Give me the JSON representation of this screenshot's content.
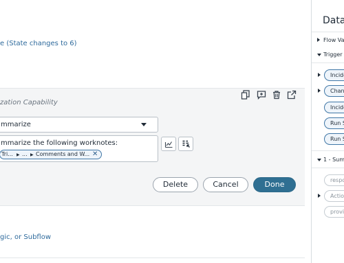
{
  "trigger": {
    "link_text": "e (State changes to 6)"
  },
  "step": {
    "title": "zation Capability",
    "capability_value": "mmarize",
    "prompt_text": "mmarize the following worknotes:",
    "pill": {
      "seg1": "Tri...",
      "seg2": "...",
      "seg3": "Comments and W..."
    },
    "close_glyph": "✕",
    "buttons": {
      "delete": "Delete",
      "cancel": "Cancel",
      "done": "Done"
    }
  },
  "add": {
    "link_text": "gic, or Subflow"
  },
  "panel": {
    "title": "Data",
    "sections": {
      "flow_variables": "Flow Va",
      "trigger": "Trigger -",
      "summarize": "1 - Summ"
    },
    "trigger_items": [
      "Incide",
      "Chan",
      "Incide",
      "Run S",
      "Run S"
    ],
    "step_items": [
      "respo",
      "Action",
      "provi"
    ]
  },
  "colors": {
    "accent": "#2f6f92",
    "link": "#2e6a9c",
    "pill_border": "#3f76a6"
  }
}
